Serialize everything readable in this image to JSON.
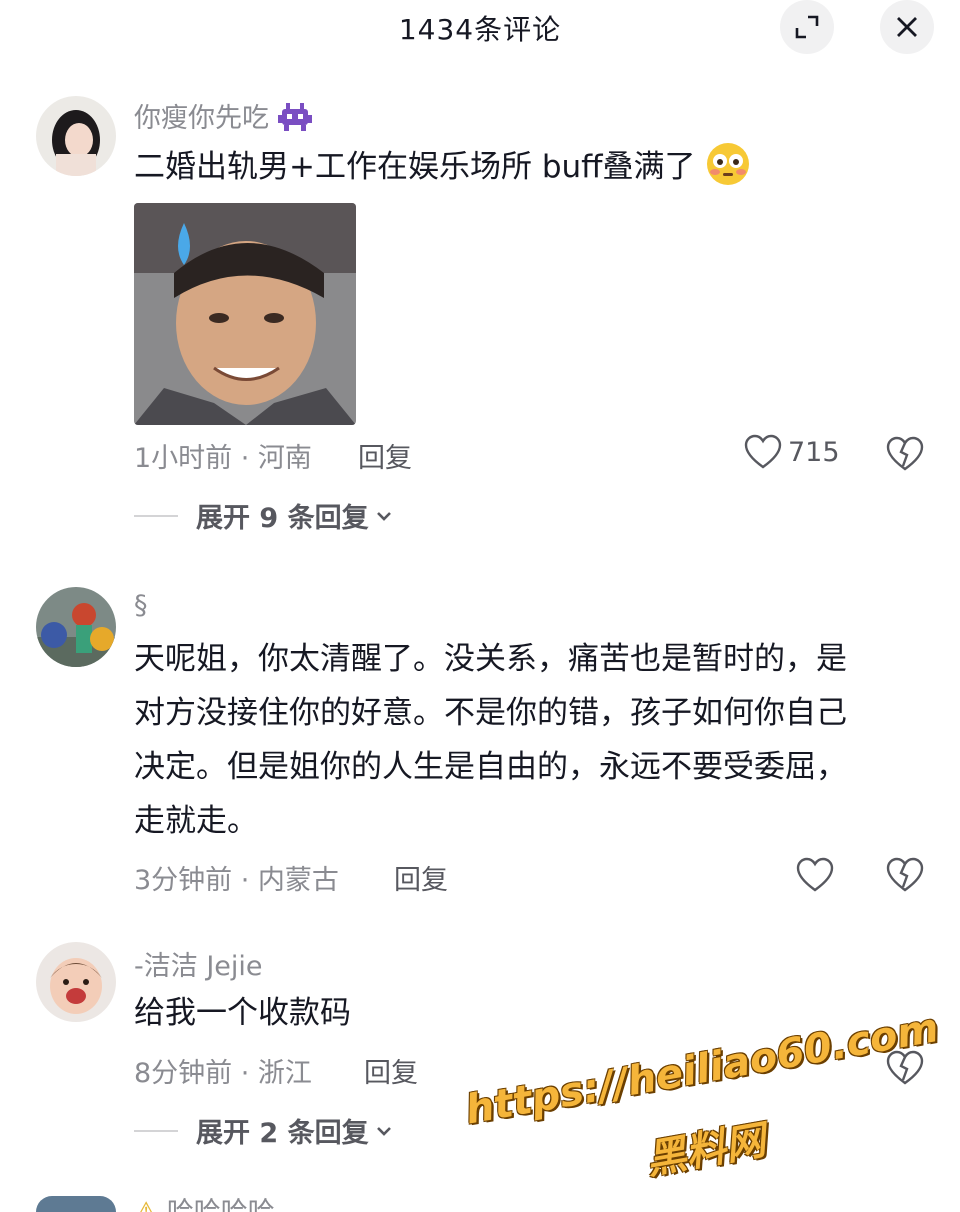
{
  "header": {
    "title": "1434条评论"
  },
  "comments": [
    {
      "username": "你瘦你先吃",
      "text": "二婚出轨男+工作在娱乐场所 buff叠满了",
      "meta": "1小时前 · 河南",
      "reply_label": "回复",
      "likes": "715",
      "expand_label": "展开 9 条回复"
    },
    {
      "username": "§",
      "text_lines": [
        "天呢姐，你太清醒了。没关系，痛苦也是暂时的，是",
        "对方没接住你的好意。不是你的错，孩子如何你自己",
        "决定。但是姐你的人生是自由的，永远不要受委屈，",
        "走就走。"
      ],
      "meta": "3分钟前 · 内蒙古",
      "reply_label": "回复"
    },
    {
      "username": "-洁洁 Jejie",
      "text": "给我一个收款码",
      "meta": "8分钟前 · 浙江",
      "reply_label": "回复",
      "expand_label": "展开 2 条回复"
    },
    {
      "username": "哈哈哈哈"
    }
  ],
  "watermark": {
    "url": "https://heiliao60.com",
    "site": "黑料网"
  },
  "icons": {
    "expand": "expand-icon",
    "close": "close-icon",
    "like": "heart-icon",
    "dislike": "broken-heart-icon",
    "chevron": "chevron-down-icon"
  }
}
